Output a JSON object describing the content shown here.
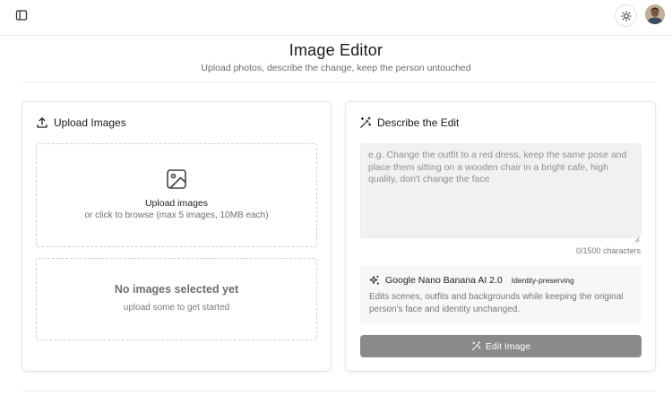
{
  "header": {
    "title": "Image Editor",
    "subtitle": "Upload photos, describe the change, keep the person untouched"
  },
  "topbar": {
    "sidebar_toggle_icon": "sidebar-panel-icon",
    "theme_icon": "sun-icon",
    "avatar_icon": "user-avatar"
  },
  "upload": {
    "title": "Upload Images",
    "icon": "upload-icon",
    "dropzone_icon": "image-icon",
    "dropzone_title": "Upload images",
    "dropzone_sub": "or click to browse (max 5 images, 10MB each)",
    "empty_title": "No images selected yet",
    "empty_sub": "upload some to get started"
  },
  "edit": {
    "title": "Describe the Edit",
    "icon": "magic-wand-icon",
    "prompt_placeholder": "e.g. Change the outfit to a red dress, keep the same pose and place them sitting on a wooden chair in a bright cafe, high quality, don't change the face",
    "prompt_value": "",
    "char_count": "0/1500 characters",
    "model_icon": "sparkles-icon",
    "model_name": "Google Nano Banana AI 2.0",
    "model_badge": "Identity-preserving",
    "model_desc": "Edits scenes, outfits and backgrounds while keeping the original person's face and identity unchanged.",
    "button_label": "Edit Image",
    "button_icon": "magic-wand-icon"
  },
  "colors": {
    "accent_button": "#8a8a8a",
    "border": "#e6e6e6",
    "muted_text": "#6b6b6b"
  }
}
